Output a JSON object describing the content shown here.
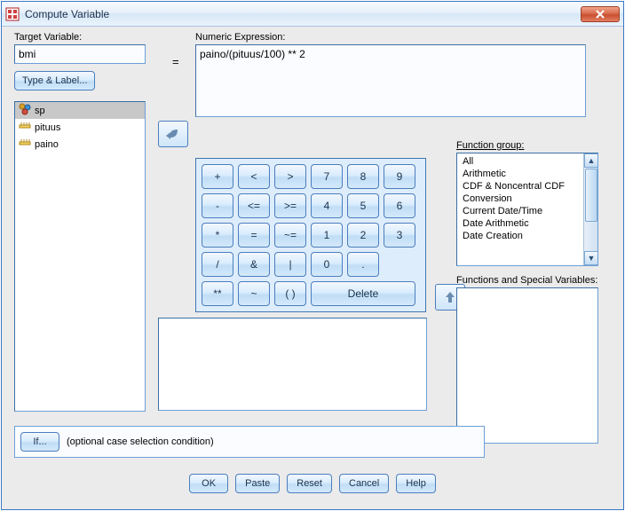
{
  "title": "Compute Variable",
  "labels": {
    "target": "Target Variable:",
    "expression": "Numeric Expression:",
    "equals": "=",
    "type_label": "Type & Label...",
    "function_group": "Function group:",
    "functions_special": "Functions and Special Variables:",
    "if": "If...",
    "if_desc": "(optional case selection condition)"
  },
  "target_value": "bmi",
  "expression_value": "paino/(pituus/100) ** 2",
  "variables": [
    {
      "name": "sp",
      "icon": "nominal",
      "selected": true
    },
    {
      "name": "pituus",
      "icon": "scale",
      "selected": false
    },
    {
      "name": "paino",
      "icon": "scale",
      "selected": false
    }
  ],
  "keypad": [
    [
      "+",
      "<",
      ">",
      "7",
      "8",
      "9"
    ],
    [
      "-",
      "<=",
      ">=",
      "4",
      "5",
      "6"
    ],
    [
      "*",
      "=",
      "~=",
      "1",
      "2",
      "3"
    ],
    [
      "/",
      "&",
      "|",
      "0",
      ".",
      null
    ],
    [
      "**",
      "~",
      "( )",
      "Delete",
      null,
      null
    ]
  ],
  "function_groups": [
    "All",
    "Arithmetic",
    "CDF & Noncentral CDF",
    "Conversion",
    "Current Date/Time",
    "Date Arithmetic",
    "Date Creation"
  ],
  "buttons": {
    "ok": "OK",
    "paste": "Paste",
    "reset": "Reset",
    "cancel": "Cancel",
    "help": "Help"
  }
}
